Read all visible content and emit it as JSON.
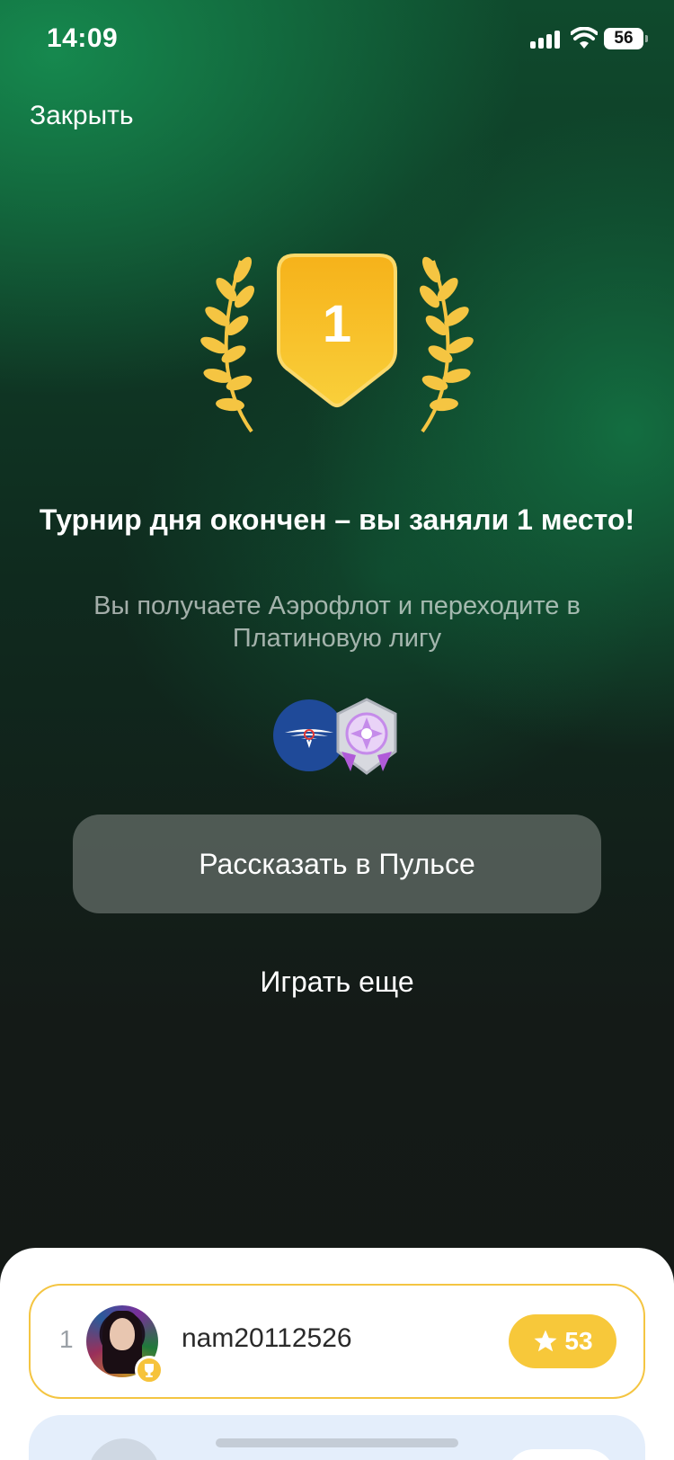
{
  "status_bar": {
    "time": "14:09",
    "battery": "56"
  },
  "header": {
    "close_label": "Закрыть"
  },
  "medal": {
    "place": "1"
  },
  "result": {
    "headline": "Турнир дня окончен – вы заняли 1 место!",
    "subtitle": "Вы получаете Аэрофлот и переходите в Платиновую лигу"
  },
  "rewards": [
    {
      "icon": "aeroflot-logo-icon",
      "brand_color": "#1f4a99"
    },
    {
      "icon": "platinum-league-badge-icon",
      "color": "#c58bea"
    }
  ],
  "actions": {
    "share_label": "Рассказать в Пульсе",
    "play_again_label": "Играть еще"
  },
  "leaderboard": {
    "rows": [
      {
        "rank": "1",
        "username": "nam20112526",
        "score": "53",
        "highlight_color": "#f4c542"
      }
    ]
  },
  "colors": {
    "accent_gold": "#f7c83a",
    "background_green": "#0f4a2d",
    "dark_background": "#141816"
  }
}
